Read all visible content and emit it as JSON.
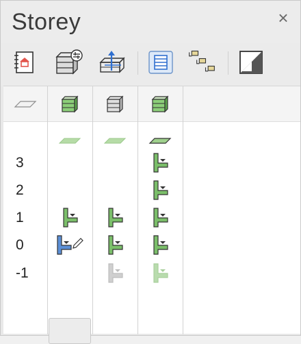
{
  "panel": {
    "title": "Storey",
    "close_glyph": "×"
  },
  "toolbar": {
    "buttons": [
      {
        "name": "storey-properties-icon"
      },
      {
        "name": "storey-settings-icon"
      },
      {
        "name": "storey-elevation-icon"
      },
      {
        "name": "list-view-icon",
        "active": true
      },
      {
        "name": "tree-hierarchy-icon"
      },
      {
        "name": "split-view-icon"
      }
    ]
  },
  "columns": [
    {
      "header_icon": "plan-plane-icon"
    },
    {
      "header_icon": "storey-stack-green-icon"
    },
    {
      "header_icon": "storey-stack-grey-icon"
    },
    {
      "header_icon": "storey-stack-green-icon"
    }
  ],
  "storeys": [
    {
      "label": ""
    },
    {
      "label": "3"
    },
    {
      "label": "2"
    },
    {
      "label": "1"
    },
    {
      "label": "0"
    },
    {
      "label": "-1"
    }
  ],
  "colors": {
    "green": "#7bbf6a",
    "green_light": "#b9dcae",
    "blue": "#5b8fd6",
    "grey": "#9a9a9a",
    "grey_light": "#cfcfcf"
  }
}
